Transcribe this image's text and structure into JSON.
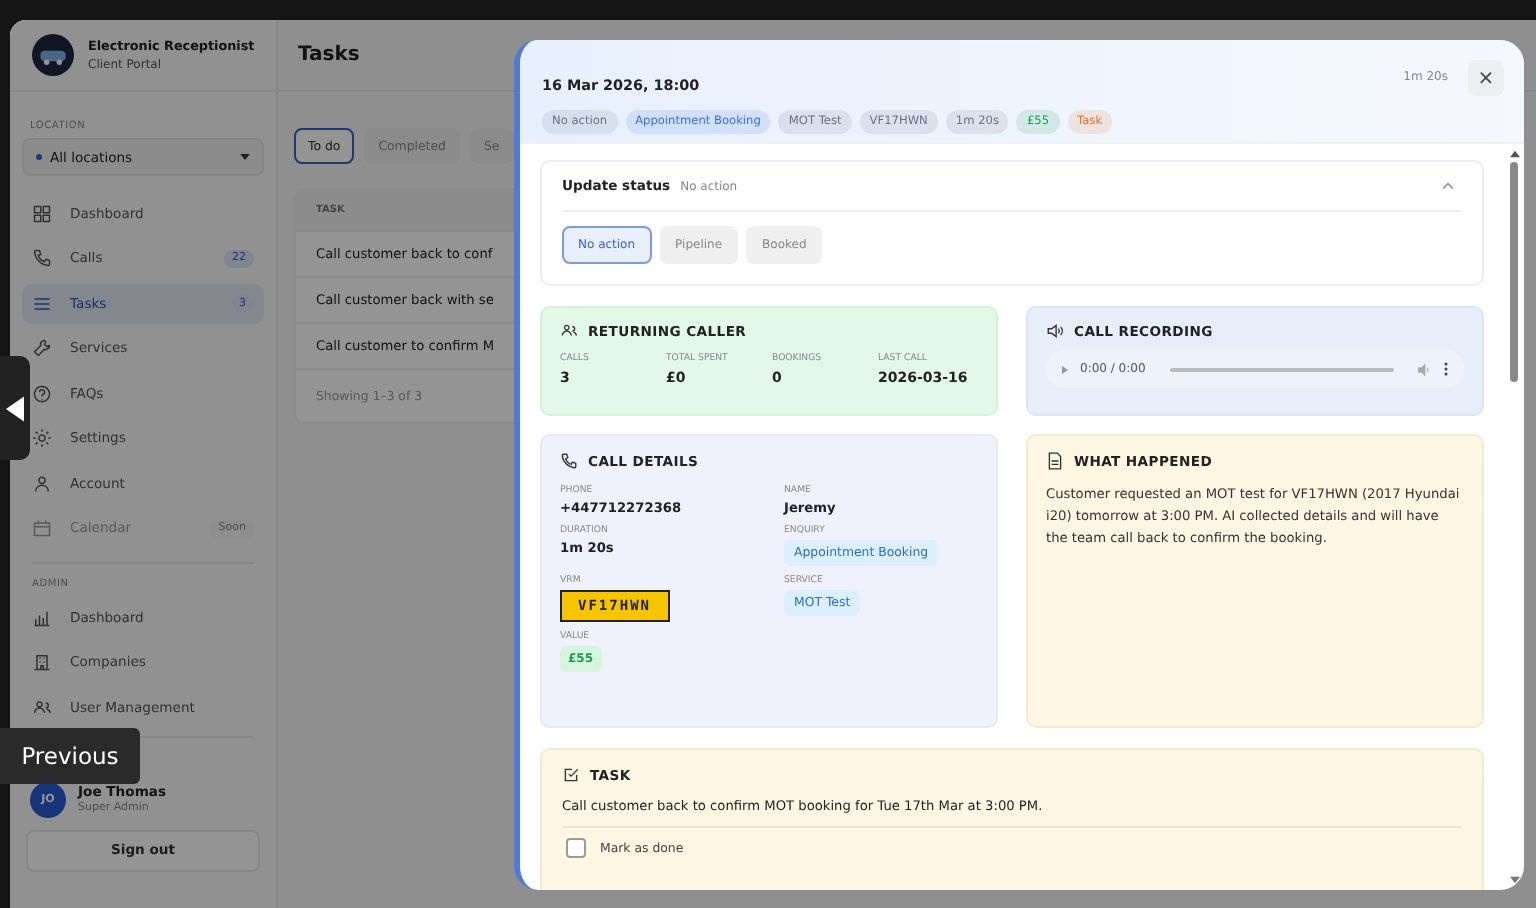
{
  "app": {
    "title": "Electronic Receptionist",
    "subtitle": "Client Portal"
  },
  "location": {
    "label": "LOCATION",
    "value": "All locations"
  },
  "nav": [
    {
      "label": "Dashboard",
      "selected": false,
      "disabled": false
    },
    {
      "label": "Calls",
      "badge": "22",
      "selected": false,
      "disabled": false
    },
    {
      "label": "Tasks",
      "badge": "3",
      "selected": true,
      "disabled": false
    },
    {
      "label": "Services",
      "selected": false,
      "disabled": false
    },
    {
      "label": "FAQs",
      "selected": false,
      "disabled": false
    },
    {
      "label": "Settings",
      "selected": false,
      "disabled": false
    },
    {
      "label": "Account",
      "selected": false,
      "disabled": false
    },
    {
      "label": "Calendar",
      "badge": "Soon",
      "selected": false,
      "disabled": true
    }
  ],
  "admin": {
    "label": "ADMIN",
    "items": [
      {
        "label": "Dashboard",
        "selected": false
      },
      {
        "label": "Companies",
        "selected": false
      },
      {
        "label": "User Management",
        "selected": false
      }
    ]
  },
  "user": {
    "initials": "JO",
    "name": "Joe Thomas",
    "role": "Super Admin"
  },
  "sign_out": "Sign out",
  "page_title": "Tasks",
  "tabs": [
    {
      "label": "To do",
      "selected": true
    },
    {
      "label": "Completed",
      "selected": false
    },
    {
      "label": "Se",
      "selected": false
    }
  ],
  "table": {
    "columns": [
      "TASK"
    ],
    "rows": [
      "Call customer back to conf",
      "Call customer back with se",
      "Call customer to confirm M"
    ],
    "footer": "Showing 1–3 of 3"
  },
  "modal": {
    "date": "16 Mar 2026, 18:00",
    "duration": "1m 20s",
    "close": "×",
    "chips": [
      {
        "label": "No action",
        "color": "#6b7280"
      },
      {
        "label": "Appointment Booking",
        "color": "#3b6fd8"
      },
      {
        "label": "MOT Test",
        "color": "#6b7280"
      },
      {
        "label": "VF17HWN",
        "color": "#6b7280"
      },
      {
        "label": "1m 20s",
        "color": "#6b7280"
      },
      {
        "label": "£55",
        "color": "#1f9d4f"
      },
      {
        "label": "Task",
        "color": "#e8702a"
      }
    ],
    "status": {
      "title": "Update status",
      "current": "No action",
      "expanded": true,
      "options": [
        {
          "label": "No action",
          "selected": true
        },
        {
          "label": "Pipeline",
          "selected": false
        },
        {
          "label": "Booked",
          "selected": false
        }
      ]
    },
    "returning": {
      "title": "RETURNING CALLER",
      "stats": [
        {
          "label": "CALLS",
          "value": "3"
        },
        {
          "label": "TOTAL SPENT",
          "value": "£0"
        },
        {
          "label": "BOOKINGS",
          "value": "0"
        },
        {
          "label": "LAST CALL",
          "value": "2026-03-16"
        }
      ]
    },
    "recording": {
      "title": "CALL RECORDING",
      "time": "0:00 / 0:00"
    },
    "details": {
      "title": "CALL DETAILS",
      "fields": [
        {
          "label": "PHONE",
          "value": "+447712272368",
          "kind": "text"
        },
        {
          "label": "NAME",
          "value": "Jeremy",
          "kind": "text"
        },
        {
          "label": "DURATION",
          "value": "1m 20s",
          "kind": "text"
        },
        {
          "label": "ENQUIRY",
          "value": "Appointment Booking",
          "kind": "chip"
        },
        {
          "label": "VRM",
          "value": "VF17HWN",
          "kind": "plate"
        },
        {
          "label": "SERVICE",
          "value": "MOT Test",
          "kind": "chip"
        },
        {
          "label": "VALUE",
          "value": "£55",
          "kind": "money"
        }
      ]
    },
    "summary": {
      "title": "WHAT HAPPENED",
      "text": "Customer requested an MOT test for VF17HWN (2017 Hyundai i20) tomorrow at 3:00 PM. AI collected details and will have the team call back to confirm the booking."
    },
    "task": {
      "title": "TASK",
      "text": "Call customer back to confirm MOT booking for Tue 17th Mar at 3:00 PM.",
      "done_label": "Mark as done",
      "checked": false
    }
  },
  "tooltip": "Previous"
}
